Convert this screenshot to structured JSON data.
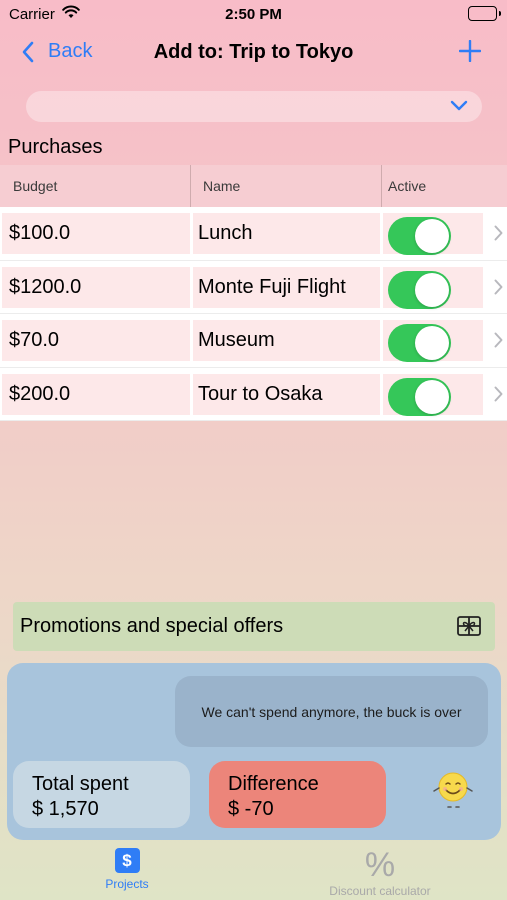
{
  "status_bar": {
    "carrier": "Carrier",
    "time": "2:50 PM"
  },
  "nav": {
    "back_label": "Back",
    "title": "Add to: Trip to Tokyo"
  },
  "dropdown": {
    "selected": ""
  },
  "section_title": "Purchases",
  "table": {
    "headers": [
      "Budget",
      "Name",
      "Active"
    ],
    "rows": [
      {
        "budget": "$100.0",
        "name": "Lunch",
        "active": true
      },
      {
        "budget": "$1200.0",
        "name": "Monte Fuji Flight",
        "active": true
      },
      {
        "budget": "$70.0",
        "name": "Museum",
        "active": true
      },
      {
        "budget": "$200.0",
        "name": "Tour to Osaka",
        "active": true
      }
    ]
  },
  "promotions": {
    "label": "Promotions and special offers",
    "icon": "gift-icon"
  },
  "summary": {
    "message": "We can't spend anymore, the buck is over",
    "total_label": "Total spent",
    "total_value": "$ 1,570",
    "difference_label": "Difference",
    "difference_value": "$ -70"
  },
  "tabs": [
    {
      "label": "Projects",
      "icon": "dollar-icon",
      "selected": true
    },
    {
      "label": "Discount calculator",
      "icon": "percent-icon",
      "selected": false
    }
  ],
  "colors": {
    "accent": "#2f7df6",
    "toggle_on": "#35c759",
    "difference_bg": "#ec857a",
    "promo_bg": "#cddcb7",
    "panel_bg": "#a8c4dc"
  }
}
